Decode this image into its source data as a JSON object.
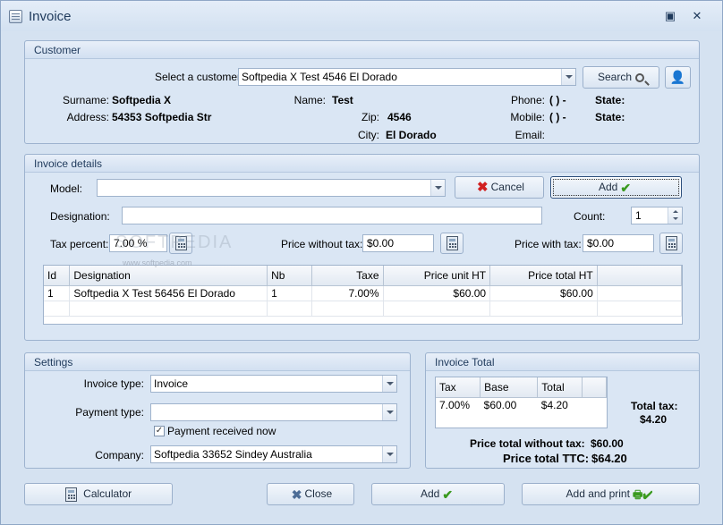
{
  "window": {
    "title": "Invoice"
  },
  "customer": {
    "group_title": "Customer",
    "select_label": "Select a customer:",
    "select_value": "Softpedia X  Test 4546 El Dorado",
    "search_label": "Search",
    "surname_label": "Surname:",
    "surname_value": "Softpedia X",
    "address_label": "Address:",
    "address_value": "54353 Softpedia Str",
    "name_label": "Name:",
    "name_value": "Test",
    "zip_label": "Zip:",
    "zip_value": "4546",
    "city_label": "City:",
    "city_value": "El Dorado",
    "phone_label": "Phone:",
    "phone_value": "(    )    -",
    "mobile_label": "Mobile:",
    "mobile_value": "(    )    -",
    "email_label": "Email:",
    "state_label": "State:",
    "state2_label": "State:"
  },
  "invoice_details": {
    "group_title": "Invoice details",
    "model_label": "Model:",
    "model_value": "",
    "cancel_label": "Cancel",
    "add_label": "Add",
    "designation_label": "Designation:",
    "designation_value": "",
    "count_label": "Count:",
    "count_value": "1",
    "tax_percent_label": "Tax percent:",
    "tax_percent_value": "7.00 %",
    "price_without_tax_label": "Price without tax:",
    "price_without_tax_value": "$0.00",
    "price_with_tax_label": "Price with tax:",
    "price_with_tax_value": "$0.00",
    "columns": [
      "Id",
      "Designation",
      "Nb",
      "Taxe",
      "Price unit HT",
      "Price total HT"
    ],
    "rows": [
      [
        "1",
        "Softpedia X Test  56456 El Dorado",
        "1",
        "7.00%",
        "$60.00",
        "$60.00"
      ]
    ]
  },
  "settings": {
    "group_title": "Settings",
    "invoice_type_label": "Invoice type:",
    "invoice_type_value": "Invoice",
    "payment_type_label": "Payment type:",
    "payment_type_value": "",
    "payment_received_label": "Payment received now",
    "company_label": "Company:",
    "company_value": "Softpedia 33652 Sindey Australia"
  },
  "invoice_total": {
    "group_title": "Invoice Total",
    "columns": [
      "Tax",
      "Base",
      "Total"
    ],
    "rows": [
      [
        "7.00%",
        "$60.00",
        "$4.20"
      ]
    ],
    "total_tax_label": "Total tax:",
    "total_tax_value": "$4.20",
    "price_without_tax_label": "Price total without tax:",
    "price_without_tax_value": "$60.00",
    "price_ttc_label": "Price total TTC:",
    "price_ttc_value": "$64.20"
  },
  "footer": {
    "calculator_label": "Calculator",
    "close_label": "Close",
    "add_label": "Add",
    "add_print_label": "Add and print"
  },
  "watermark": {
    "text": "SOFTPEDIA",
    "url": "www.softpedia.com"
  }
}
